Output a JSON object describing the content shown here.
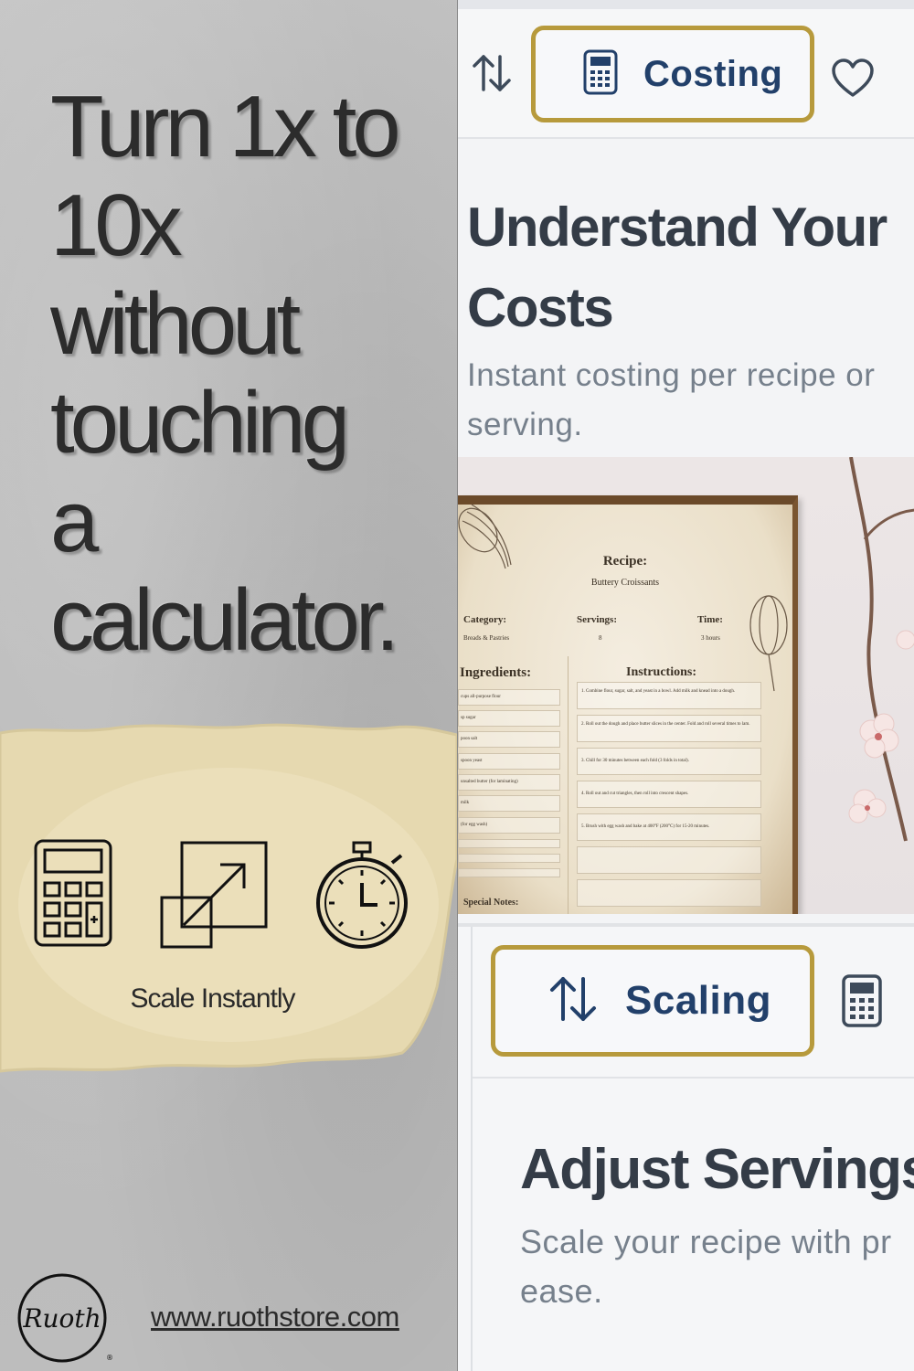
{
  "left": {
    "headline_lines": [
      "Turn 1x to",
      "10x",
      "without",
      "touching",
      "a",
      "calculator."
    ],
    "icons": [
      "calculator-icon",
      "scale-resize-icon",
      "stopwatch-icon"
    ],
    "caption": "Scale Instantly",
    "logo_text": "Ruoth",
    "url": "www.ruothstore.com"
  },
  "top_screen": {
    "sort_icon": "sort-arrows-icon",
    "tab_label": "Costing",
    "tab_icon": "calculator-icon",
    "heart_icon": "heart-icon",
    "heading_lines": [
      "Understand Your",
      "Costs"
    ],
    "subtitle_lines": [
      "Instant costing per recipe or",
      "serving."
    ]
  },
  "recipe_card": {
    "title": "Recipe:",
    "name": "Buttery Croissants",
    "category_label": "Category:",
    "category_value": "Breads & Pastries",
    "servings_label": "Servings:",
    "servings_value": "8",
    "time_label": "Time:",
    "time_value": "3 hours",
    "ingredients_label": "Ingredients:",
    "instructions_label": "Instructions:",
    "ingredients": [
      "cups all-purpose flour",
      "sp sugar",
      "poon salt",
      "spoon yeast",
      "unsalted butter (for laminating)",
      "milk",
      "(for egg wash)"
    ],
    "instructions": [
      "1. Combine flour, sugar, salt, and yeast in a bowl. Add milk and knead into a dough.",
      "2. Roll out the dough and place butter slices in the center. Fold and roll several times to lam.",
      "3. Chill for 30 minutes between each fold (3 folds in total).",
      "4. Roll out and cut triangles, then roll into crescent shapes.",
      "5. Brush with egg wash and bake at 400°F (200°C) for 15-20 minutes."
    ],
    "notes_label": "Special Notes:"
  },
  "bottom_screen": {
    "tab_label": "Scaling",
    "tab_icon": "sort-arrows-icon",
    "side_icon": "calculator-icon",
    "heading": "Adjust Servings",
    "subtitle_lines": [
      "Scale your recipe with pr",
      "ease."
    ]
  },
  "colors": {
    "tab_border": "#b79a3c",
    "tab_text": "#22406a",
    "heading_text": "#343c47",
    "subtitle_text": "#76808c",
    "paper_yellow": "#e8dcb4"
  }
}
